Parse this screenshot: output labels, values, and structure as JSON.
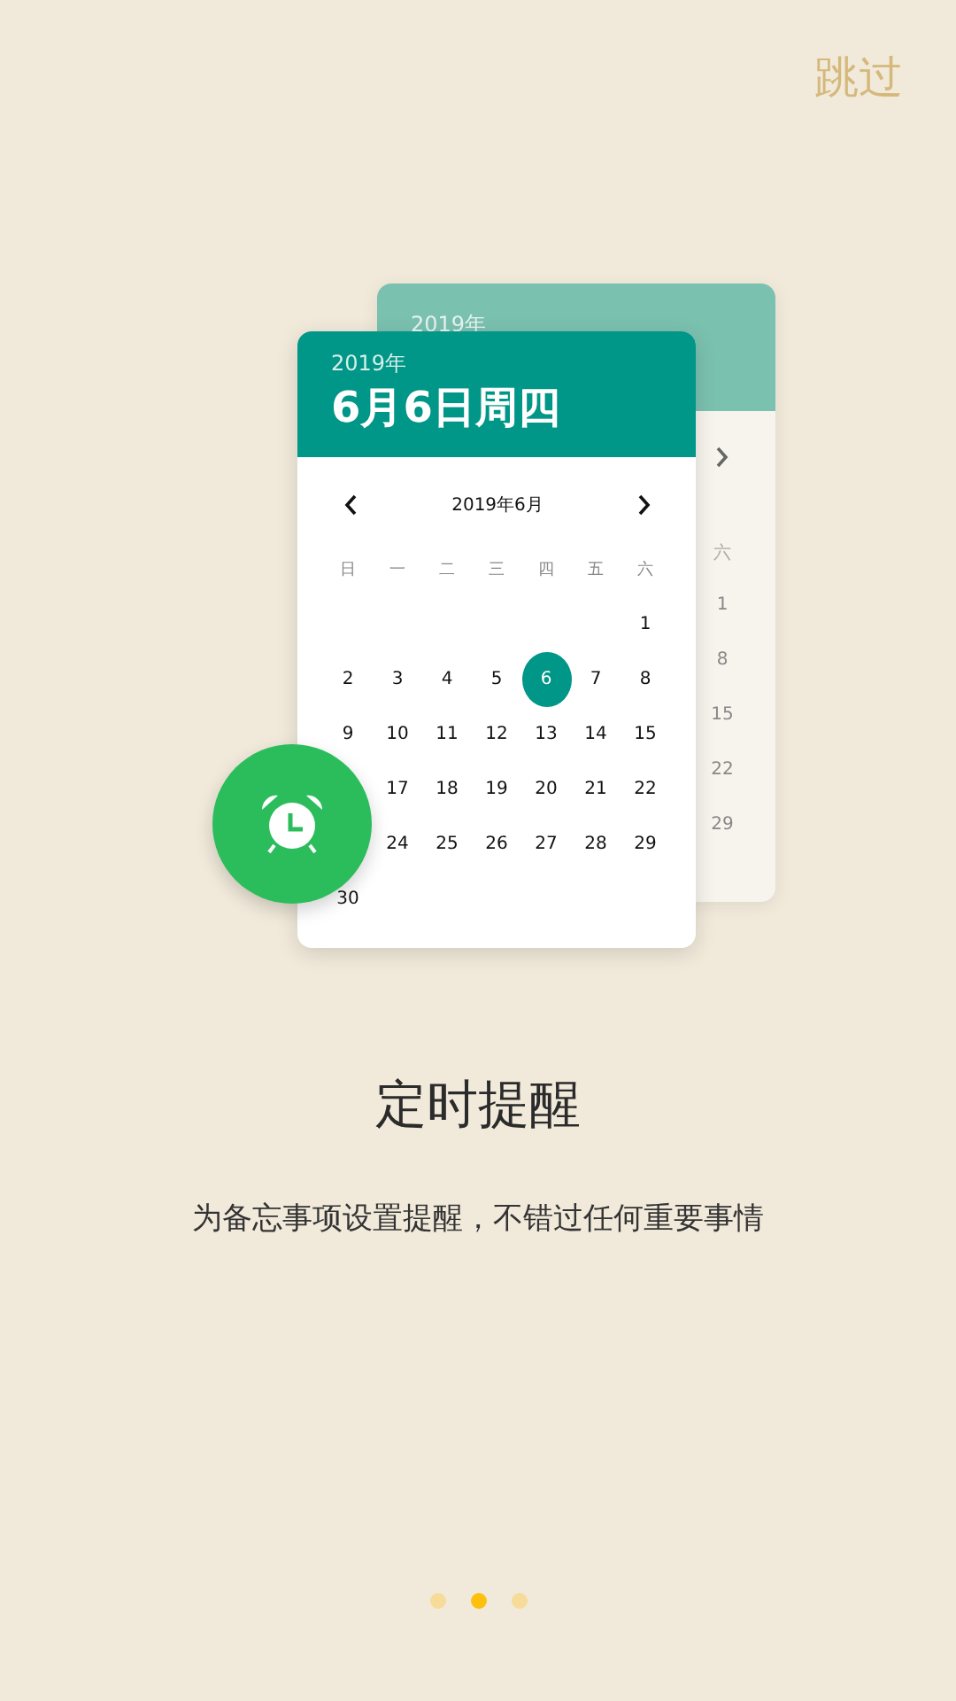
{
  "skip_button": "跳过",
  "back_calendar": {
    "year": "2019年",
    "weekday": "六",
    "days": [
      "1",
      "8",
      "15",
      "22",
      "29"
    ]
  },
  "front_calendar": {
    "year": "2019年",
    "date": "6月6日周四",
    "month": "2019年6月",
    "weekdays": [
      "日",
      "一",
      "二",
      "三",
      "四",
      "五",
      "六"
    ],
    "weeks": [
      [
        {
          "label": "1",
          "selected": false
        }
      ],
      [
        {
          "label": "2",
          "selected": false
        },
        {
          "label": "3",
          "selected": false
        },
        {
          "label": "4",
          "selected": false
        },
        {
          "label": "5",
          "selected": false
        },
        {
          "label": "6",
          "selected": true
        },
        {
          "label": "7",
          "selected": false
        },
        {
          "label": "8",
          "selected": false
        }
      ],
      [
        {
          "label": "9",
          "selected": false
        },
        {
          "label": "10",
          "selected": false
        },
        {
          "label": "11",
          "selected": false
        },
        {
          "label": "12",
          "selected": false
        },
        {
          "label": "13",
          "selected": false
        },
        {
          "label": "14",
          "selected": false
        },
        {
          "label": "15",
          "selected": false
        }
      ],
      [
        {
          "label": "17",
          "selected": false
        },
        {
          "label": "18",
          "selected": false
        },
        {
          "label": "19",
          "selected": false
        },
        {
          "label": "20",
          "selected": false
        },
        {
          "label": "21",
          "selected": false
        },
        {
          "label": "22",
          "selected": false
        }
      ],
      [
        {
          "label": "24",
          "selected": false
        },
        {
          "label": "25",
          "selected": false
        },
        {
          "label": "26",
          "selected": false
        },
        {
          "label": "27",
          "selected": false
        },
        {
          "label": "28",
          "selected": false
        },
        {
          "label": "29",
          "selected": false
        }
      ],
      [
        {
          "label": "30",
          "selected": false
        }
      ]
    ]
  },
  "title": "定时提醒",
  "subtitle": "为备忘事项设置提醒，不错过任何重要事情",
  "pager": [
    {
      "selected": false
    },
    {
      "selected": true
    },
    {
      "selected": false
    }
  ]
}
